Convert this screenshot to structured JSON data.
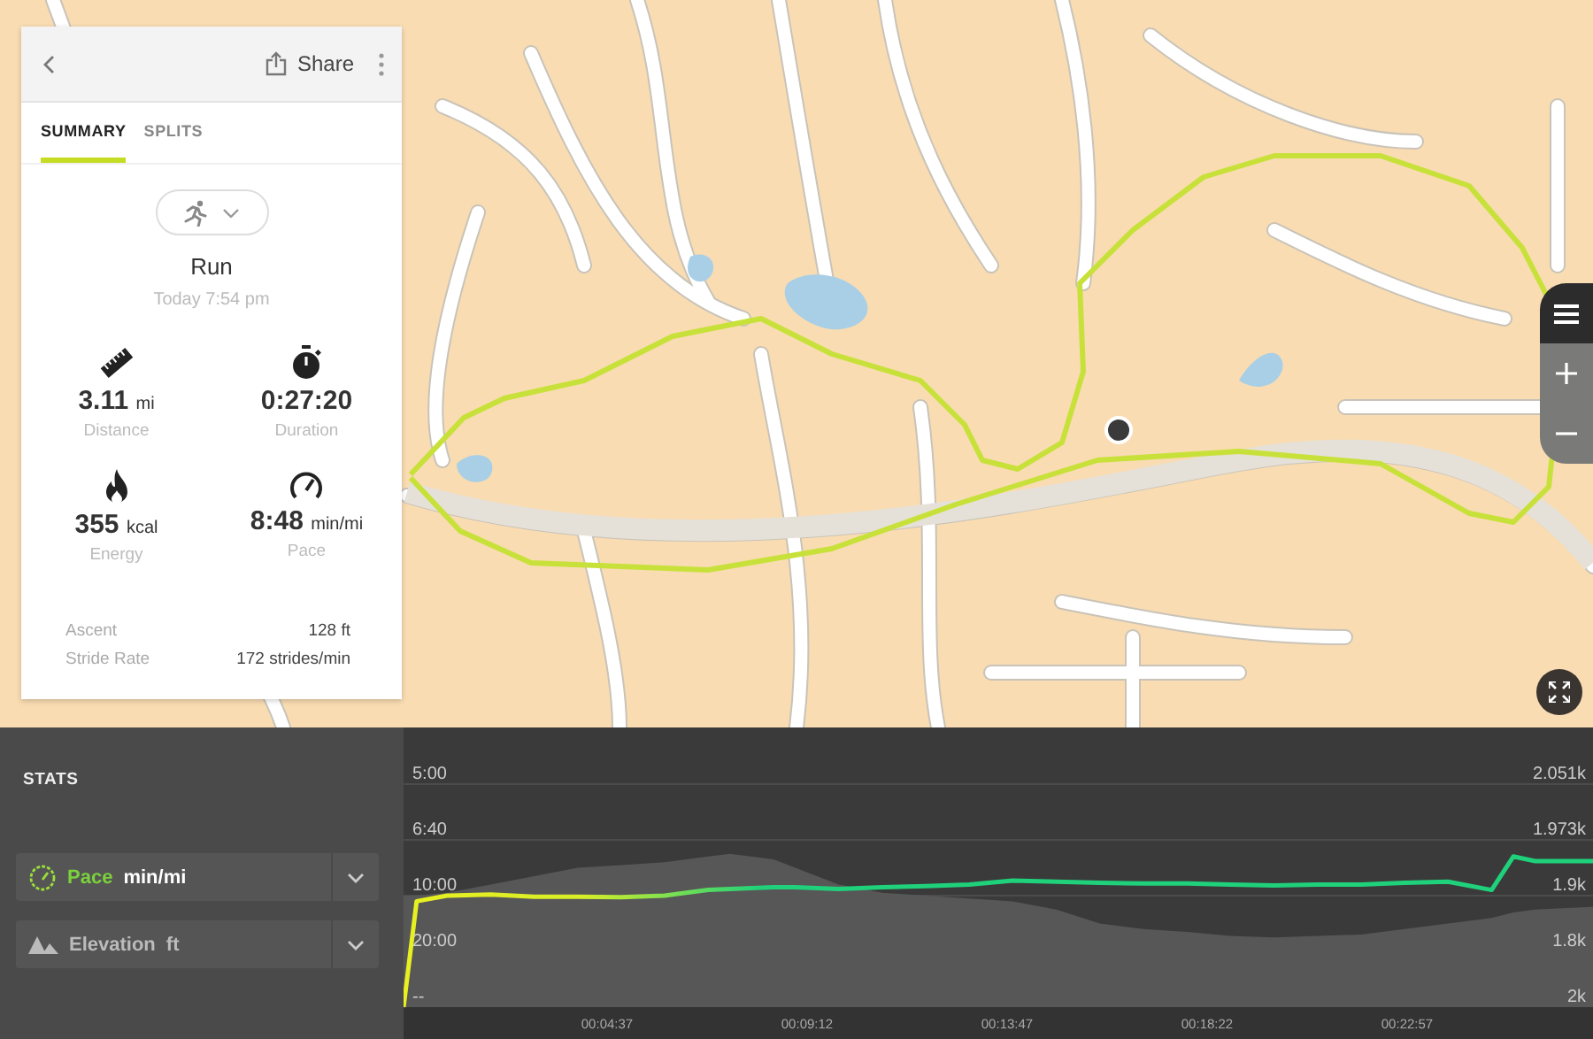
{
  "activity_card": {
    "share_label": "Share",
    "tabs": [
      {
        "label": "SUMMARY",
        "selected": true
      },
      {
        "label": "SPLITS",
        "selected": false
      }
    ],
    "activity": {
      "name": "Run",
      "time": "Today 7:54 pm"
    },
    "metrics": [
      {
        "kind": "distance",
        "value": "3.11",
        "unit": "mi",
        "label": "Distance"
      },
      {
        "kind": "duration",
        "value": "0:27:20",
        "label": "Duration"
      },
      {
        "kind": "energy",
        "value": "355",
        "unit": "kcal",
        "label": "Energy"
      },
      {
        "kind": "pace",
        "value": "8:48",
        "unit": "min/mi",
        "label": "Pace"
      }
    ],
    "details": [
      {
        "label": "Ascent",
        "value": "128 ft"
      },
      {
        "label": "Stride Rate",
        "value": "172 strides/min"
      }
    ]
  },
  "stats_panel": {
    "title": "STATS",
    "selectors": [
      {
        "kind": "pace",
        "name": "Pace",
        "unit": "min/mi",
        "active": true
      },
      {
        "kind": "elevation",
        "name": "Elevation",
        "unit": "ft",
        "active": false
      }
    ]
  },
  "chart": {
    "left_axis_labels": [
      "5:00",
      "6:40",
      "10:00",
      "20:00",
      "--"
    ],
    "right_axis_labels": [
      "2.051k",
      "1.973k",
      "1.9k",
      "1.8k",
      "2k"
    ],
    "time_labels": [
      "00:04:37",
      "00:09:12",
      "00:13:47",
      "00:18:22",
      "00:22:57"
    ]
  }
}
